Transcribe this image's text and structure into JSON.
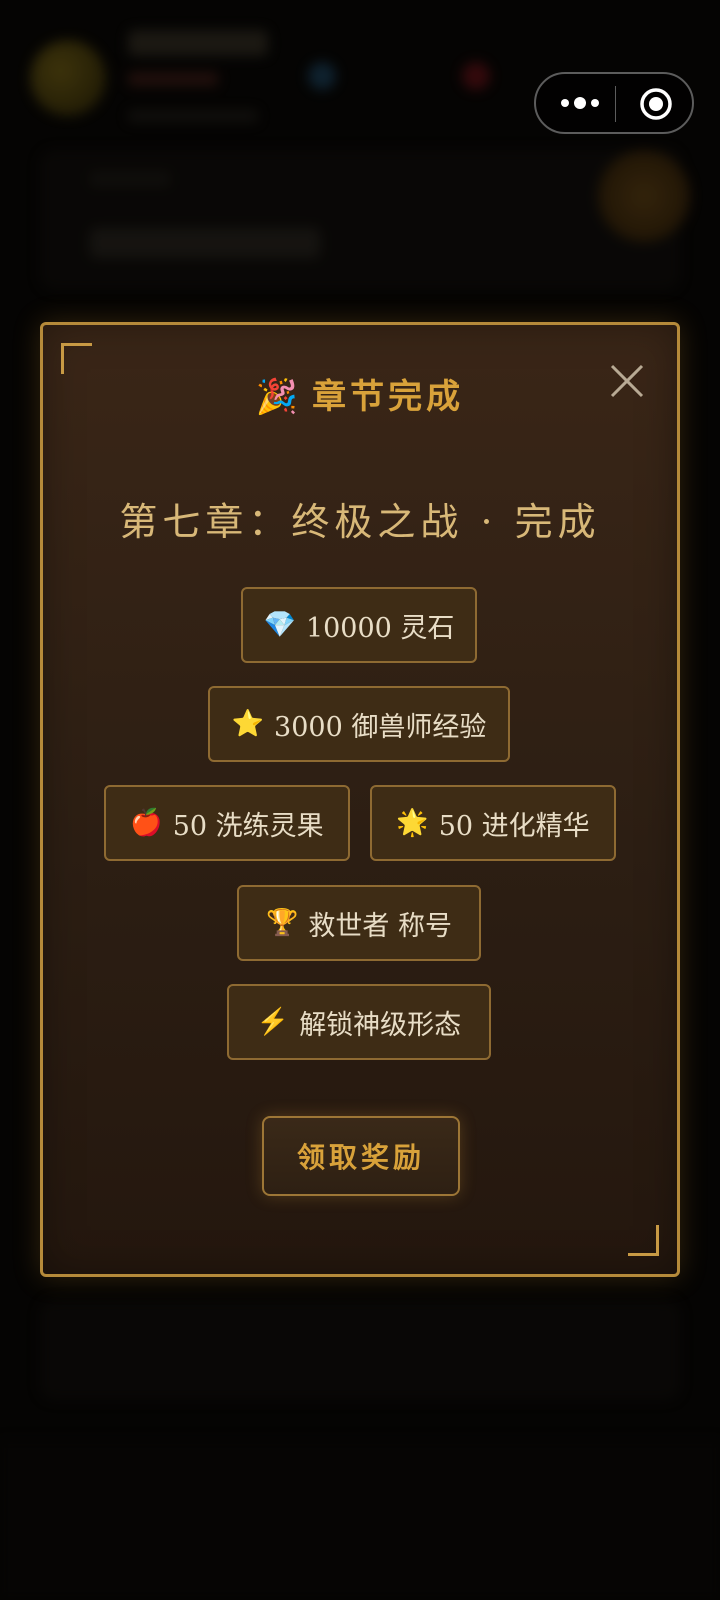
{
  "capsule": {
    "more_icon": "more-dots-icon",
    "close_icon": "mini-program-close-icon"
  },
  "modal": {
    "header": {
      "emoji": "🎉",
      "title": "章节完成"
    },
    "close_icon": "close-x-icon",
    "chapter_title": "第七章：终极之战 · 完成",
    "rewards": [
      {
        "icon": "💎",
        "label": "10000 灵石"
      },
      {
        "icon": "⭐",
        "label": "3000 御兽师经验"
      },
      {
        "icon": "🍎",
        "label": "50 洗练灵果"
      },
      {
        "icon": "🌟",
        "label": "50 进化精华"
      },
      {
        "icon": "🏆",
        "label": "救世者 称号"
      },
      {
        "icon": "⚡",
        "label": "解锁神级形态"
      }
    ],
    "claim_button": "领取奖励"
  },
  "colors": {
    "accent_gold": "#d9a23a",
    "border_gold": "#b58a3a",
    "panel_brown": "#2c1e13",
    "reward_bg": "#3e2c15",
    "text_light": "#e8ddc6"
  }
}
